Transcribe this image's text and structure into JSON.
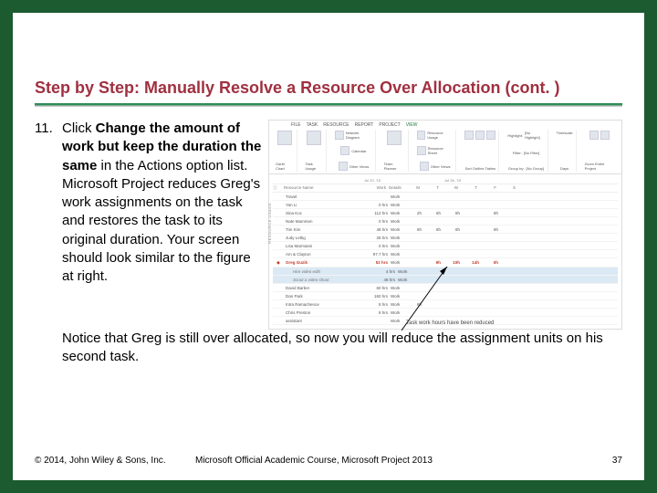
{
  "title": "Step by Step: Manually Resolve a Resource Over Allocation (cont. )",
  "step": {
    "number": "11.",
    "pre": "Click ",
    "bold": "Change the amount of work but keep the duration the same",
    "post": " in the Actions option list. Microsoft Project reduces Greg's work assignments on the task and restores the task to its original duration. Your screen should look similar to the figure at right.",
    "continuation": "Notice that Greg is still over allocated, so now you will reduce the assignment units on his second task."
  },
  "figure": {
    "tabs": [
      "FILE",
      "TASK",
      "RESOURCE",
      "REPORT",
      "PROJECT",
      "VIEW"
    ],
    "ribbon": {
      "g1": "Gantt Chart",
      "g2": "Task Usage",
      "g3": "Team Planner",
      "g3b": "Other Views",
      "g4a": "Network Diagram",
      "g4b": "Calendar",
      "g5a": "Resource Usage",
      "g5b": "Resource Sheet",
      "g5c": "Other Views",
      "g6": "Sort Outline Tables",
      "g7a": "Highlight:",
      "g7b": "Filter:",
      "g7c": "Group by:",
      "g7av": "[No Highlight]",
      "g7bv": "[No Filter]",
      "g7cv": "[No Group]",
      "g8": "Timescale",
      "g8b": "Days",
      "g9": "Zoom Entire Project",
      "title": "RESOURCE USAGE TOOLS"
    },
    "side": "RESOURCE USAGE",
    "dates": [
      "Jul 20, '15",
      "Jul 26, '15"
    ],
    "header": {
      "name": "Resource Name",
      "work": "Work",
      "det": "Details",
      "days": [
        "M",
        "T",
        "W",
        "T",
        "F",
        "S"
      ]
    },
    "rows": [
      {
        "i": "",
        "n": "Travel",
        "w": "",
        "d": "Work",
        "vals": [
          "",
          "",
          "",
          "",
          "",
          ""
        ]
      },
      {
        "i": "",
        "n": "Yan Li",
        "w": "0 hrs",
        "d": "Work",
        "vals": [
          "",
          "",
          "",
          "",
          "",
          ""
        ]
      },
      {
        "i": "",
        "n": "Sina Koc",
        "w": "112 hrs",
        "d": "Work",
        "vals": [
          "2h",
          "6h",
          "8h",
          "",
          "8h",
          ""
        ]
      },
      {
        "i": "",
        "n": "Nate Mammen",
        "w": "0 hrs",
        "d": "Work",
        "vals": [
          "",
          "",
          "",
          "",
          "",
          ""
        ]
      },
      {
        "i": "",
        "n": "Tim Kim",
        "w": "48 hrs",
        "d": "Work",
        "vals": [
          "8h",
          "8h",
          "8h",
          "",
          "8h",
          ""
        ]
      },
      {
        "i": "",
        "n": "Judy Lettig",
        "w": "28 hrs",
        "d": "Work",
        "vals": [
          "",
          "",
          "",
          "",
          "",
          ""
        ]
      },
      {
        "i": "",
        "n": "Lisa Marmiami",
        "w": "0 hrs",
        "d": "Work",
        "vals": [
          "",
          "",
          "",
          "",
          "",
          ""
        ]
      },
      {
        "i": "",
        "n": "Am & Clayton",
        "w": "97.7 hrs",
        "d": "Work",
        "vals": [
          "",
          "",
          "",
          "",
          "",
          ""
        ]
      },
      {
        "i": "◆",
        "warn": true,
        "n": "Greg Guzik",
        "w": "52 hrs",
        "d": "Work",
        "vals": [
          "",
          "9h",
          "10h",
          "14h",
          "0h",
          ""
        ]
      },
      {
        "i": "",
        "sel": true,
        "indent": true,
        "n": "Hire video editi",
        "w": "4 hrs",
        "d": "Work",
        "vals": [
          "",
          "",
          "",
          "",
          "",
          ""
        ]
      },
      {
        "i": "",
        "sel": true,
        "indent": true,
        "n": "Scout a video shoot",
        "w": "48 hrs",
        "d": "Work",
        "vals": [
          "",
          "",
          "",
          "",
          "",
          ""
        ]
      },
      {
        "i": "",
        "n": "David Barber",
        "w": "60 hrs",
        "d": "Work",
        "vals": [
          "",
          "",
          "",
          "",
          "",
          ""
        ]
      },
      {
        "i": "",
        "n": "Dan Park",
        "w": "160 hrs",
        "d": "Work",
        "vals": [
          "",
          "",
          "",
          "",
          "",
          ""
        ]
      },
      {
        "i": "",
        "n": "Intra Ramachenov",
        "w": "8 hrs",
        "d": "Work",
        "vals": [
          "8h",
          "",
          "",
          "",
          "",
          ""
        ]
      },
      {
        "i": "",
        "n": "Chris Preston",
        "w": "8 hrs",
        "d": "Work",
        "vals": [
          "",
          "",
          "",
          "",
          "",
          ""
        ]
      },
      {
        "i": "",
        "n": "assistant",
        "w": "",
        "d": "Work",
        "vals": [
          "",
          "",
          "",
          "",
          "",
          ""
        ]
      }
    ],
    "caption": "Task work hours have been reduced"
  },
  "footer": {
    "left": "© 2014, John Wiley & Sons, Inc.",
    "mid": "Microsoft Official Academic Course, Microsoft Project 2013",
    "right": "37"
  }
}
